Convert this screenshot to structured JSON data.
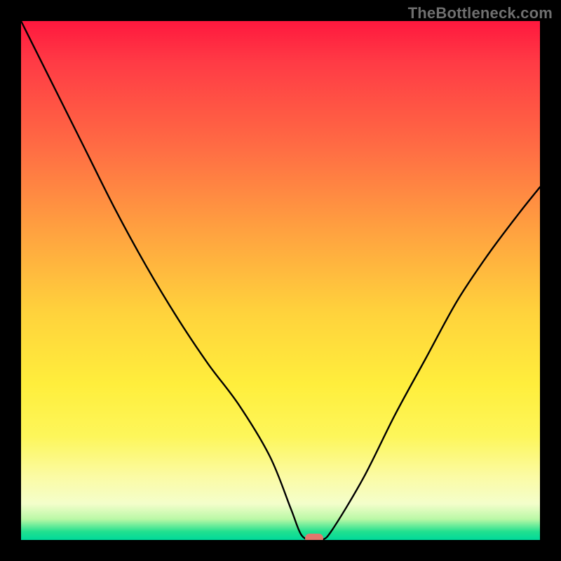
{
  "watermark": "TheBottleneck.com",
  "chart_data": {
    "type": "line",
    "title": "",
    "xlabel": "",
    "ylabel": "",
    "xlim": [
      0,
      100
    ],
    "ylim": [
      0,
      100
    ],
    "grid": false,
    "legend": false,
    "series": [
      {
        "name": "bottleneck-curve",
        "x": [
          0,
          6,
          12,
          18,
          24,
          30,
          36,
          42,
          48,
          52,
          54,
          56,
          58,
          60,
          66,
          72,
          78,
          84,
          90,
          96,
          100
        ],
        "values": [
          100,
          88,
          76,
          64,
          53,
          43,
          34,
          26,
          16,
          6,
          1,
          0,
          0,
          2,
          12,
          24,
          35,
          46,
          55,
          63,
          68
        ]
      }
    ],
    "annotations": [
      {
        "name": "optimal-marker",
        "x": 56.5,
        "y": 0,
        "color": "#e0786d"
      }
    ],
    "background_gradient": {
      "direction": "vertical",
      "description": "red (top, high bottleneck) to green (bottom, no bottleneck)",
      "stops": [
        {
          "pos": 0,
          "color": "#ff183e"
        },
        {
          "pos": 40,
          "color": "#ffa040"
        },
        {
          "pos": 70,
          "color": "#ffee3c"
        },
        {
          "pos": 93,
          "color": "#f4fecb"
        },
        {
          "pos": 100,
          "color": "#00d99a"
        }
      ]
    }
  }
}
